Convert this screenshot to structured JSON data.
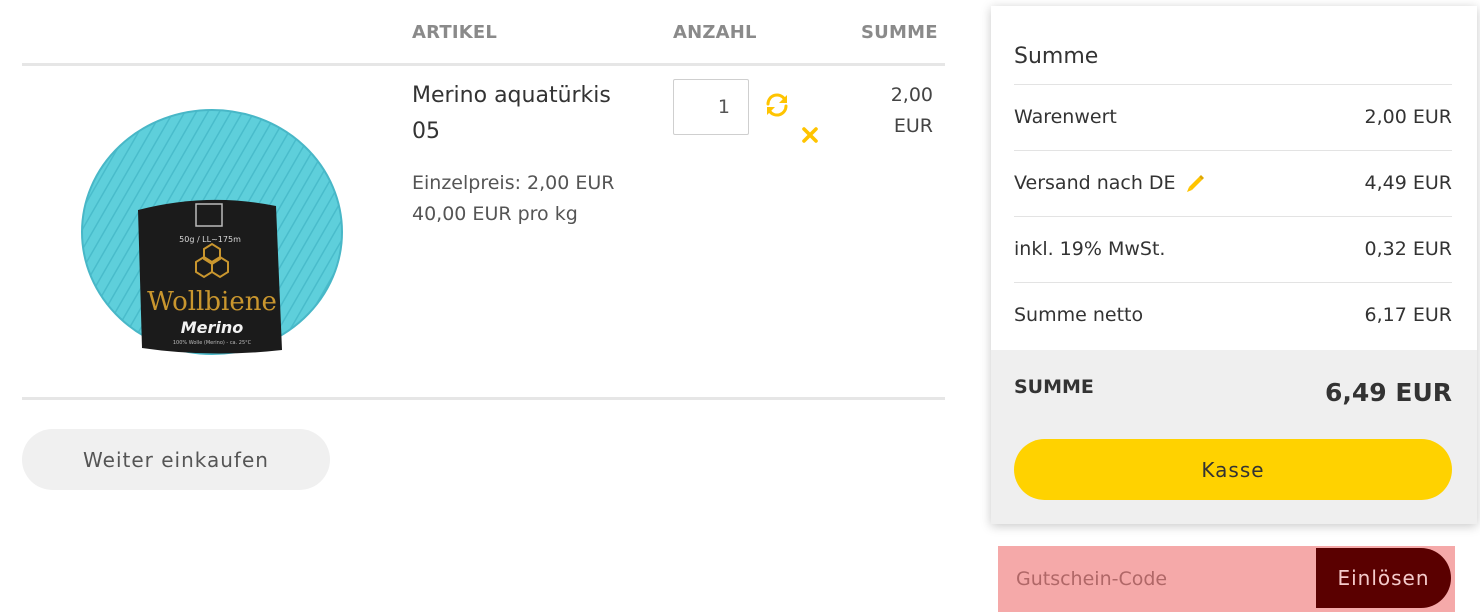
{
  "table": {
    "headers": {
      "item": "ARTIKEL",
      "quantity": "ANZAHL",
      "total": "SUMME"
    }
  },
  "item": {
    "title_line1": "Merino aquatürkis",
    "title_line2": "05",
    "unit_price": "Einzelpreis: 2,00 EUR",
    "price_per_kg": "40,00 EUR pro kg",
    "quantity": "1",
    "line_total_amount": "2,00",
    "line_total_currency": "EUR",
    "image": {
      "label_size": "50g / LL~175m",
      "brand": "Wollbiene",
      "product": "Merino",
      "composition": "100% Wolle (Merino) - ca. 25°C",
      "yarn_color": "#5ecfdb"
    }
  },
  "actions": {
    "continue_shopping": "Weiter einkaufen"
  },
  "summary": {
    "title": "Summe",
    "rows": [
      {
        "label": "Warenwert",
        "value": "2,00 EUR"
      },
      {
        "label": "Versand nach DE",
        "value": "4,49 EUR"
      },
      {
        "label": "inkl. 19% MwSt.",
        "value": "0,32 EUR"
      },
      {
        "label": "Summe netto",
        "value": "6,17 EUR"
      }
    ],
    "total_label": "SUMME",
    "total_value": "6,49 EUR",
    "checkout": "Kasse"
  },
  "coupon": {
    "placeholder": "Gutschein-Code",
    "redeem": "Einlösen"
  },
  "colors": {
    "accent": "#ffd200",
    "redeem_bg": "#5a0000",
    "coupon_bg": "#f5a9a9"
  },
  "icons": {
    "refresh": "refresh-icon",
    "remove": "close-icon",
    "edit_shipping": "pencil-icon"
  }
}
